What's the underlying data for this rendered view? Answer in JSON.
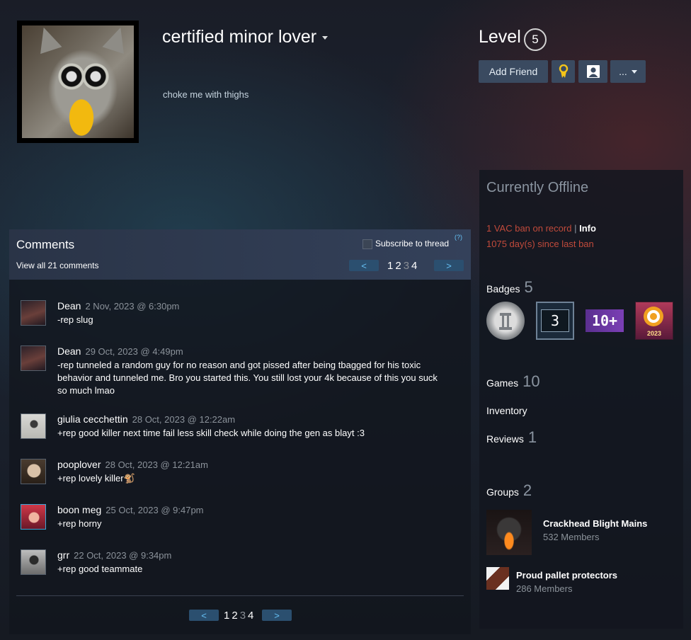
{
  "profile": {
    "name": "certified minor lover",
    "summary": "choke me with thighs",
    "level_label": "Level",
    "level": "5"
  },
  "actions": {
    "add_friend": "Add Friend",
    "more": "..."
  },
  "comments": {
    "title": "Comments",
    "view_all": "View all 21 comments",
    "subscribe": "Subscribe to thread",
    "help": "(?)",
    "prev": "<",
    "next": ">",
    "pages": [
      "1",
      "2",
      "3",
      "4"
    ],
    "current_page": "3",
    "items": [
      {
        "author": "Dean",
        "time": "2 Nov, 2023 @ 6:30pm",
        "text": "-rep slug",
        "avatar_color": "#3a2a30"
      },
      {
        "author": "Dean",
        "time": "29 Oct, 2023 @ 4:49pm",
        "text": "-rep tunneled a random guy for no reason and got pissed after being tbagged for his toxic behavior and tunneled me. Bro you started this. You still lost your 4k because of this you suck so much lmao",
        "avatar_color": "#3a2a30"
      },
      {
        "author": "giulia cecchettin",
        "time": "28 Oct, 2023 @ 12:22am",
        "text": "+rep good killer next time fail less skill check while doing the gen as blayt :3",
        "avatar_color": "#c9c9c4"
      },
      {
        "author": "pooplover",
        "time": "28 Oct, 2023 @ 12:21am",
        "text": "+rep lovely killer🐒",
        "avatar_color": "#6a5a4a"
      },
      {
        "author": "boon meg",
        "time": "25 Oct, 2023 @ 9:47pm",
        "text": "+rep horny",
        "avatar_color": "#b0323a"
      },
      {
        "author": "grr",
        "time": "22 Oct, 2023 @ 9:34pm",
        "text": "+rep good teammate",
        "avatar_color": "#9a9a9a"
      }
    ]
  },
  "sidebar": {
    "status": "Currently Offline",
    "vac_text": "1 VAC ban on record",
    "vac_sep": "|",
    "vac_info": "Info",
    "vac_since": "1075 day(s) since last ban",
    "badges_label": "Badges",
    "badges_count": "5",
    "badge_3_text": "3",
    "badge_10_text": "10+",
    "badge_2023_text": "2023",
    "games_label": "Games",
    "games_count": "10",
    "inventory_label": "Inventory",
    "reviews_label": "Reviews",
    "reviews_count": "1",
    "groups_label": "Groups",
    "groups_count": "2",
    "groups": [
      {
        "name": "Crackhead Blight Mains",
        "members": "532 Members"
      },
      {
        "name": "Proud pallet protectors",
        "members": "286 Members"
      }
    ]
  }
}
